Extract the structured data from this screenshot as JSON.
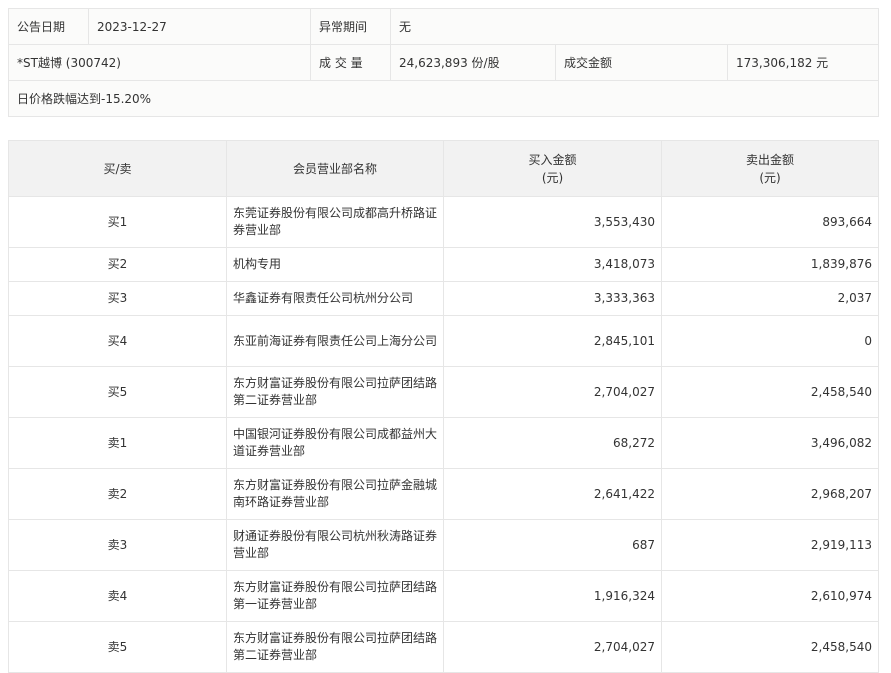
{
  "info": {
    "date_label": "公告日期",
    "date": "2023-12-27",
    "period_label": "异常期间",
    "period": "无",
    "stock": "*ST越博 (300742)",
    "volume_label": "成 交 量",
    "volume": "24,623,893 份/股",
    "amount_label": "成交金额",
    "amount": "173,306,182 元",
    "reason": "日价格跌幅达到-15.20%"
  },
  "table": {
    "headers": [
      "买/卖",
      "会员营业部名称",
      "买入金额\n(元)",
      "卖出金额\n(元)"
    ],
    "rows": [
      {
        "side": "买1",
        "name": "东莞证券股份有限公司成都高升桥路证券营业部",
        "buy": "3,553,430",
        "sell": "893,664"
      },
      {
        "side": "买2",
        "name": "机构专用",
        "buy": "3,418,073",
        "sell": "1,839,876"
      },
      {
        "side": "买3",
        "name": "华鑫证券有限责任公司杭州分公司",
        "buy": "3,333,363",
        "sell": "2,037"
      },
      {
        "side": "买4",
        "name": "东亚前海证券有限责任公司上海分公司",
        "buy": "2,845,101",
        "sell": "0"
      },
      {
        "side": "买5",
        "name": "东方财富证券股份有限公司拉萨团结路第二证券营业部",
        "buy": "2,704,027",
        "sell": "2,458,540"
      },
      {
        "side": "卖1",
        "name": "中国银河证券股份有限公司成都益州大道证券营业部",
        "buy": "68,272",
        "sell": "3,496,082"
      },
      {
        "side": "卖2",
        "name": "东方财富证券股份有限公司拉萨金融城南环路证券营业部",
        "buy": "2,641,422",
        "sell": "2,968,207"
      },
      {
        "side": "卖3",
        "name": "财通证券股份有限公司杭州秋涛路证券营业部",
        "buy": "687",
        "sell": "2,919,113"
      },
      {
        "side": "卖4",
        "name": "东方财富证券股份有限公司拉萨团结路第一证券营业部",
        "buy": "1,916,324",
        "sell": "2,610,974"
      },
      {
        "side": "卖5",
        "name": "东方财富证券股份有限公司拉萨团结路第二证券营业部",
        "buy": "2,704,027",
        "sell": "2,458,540"
      }
    ]
  }
}
